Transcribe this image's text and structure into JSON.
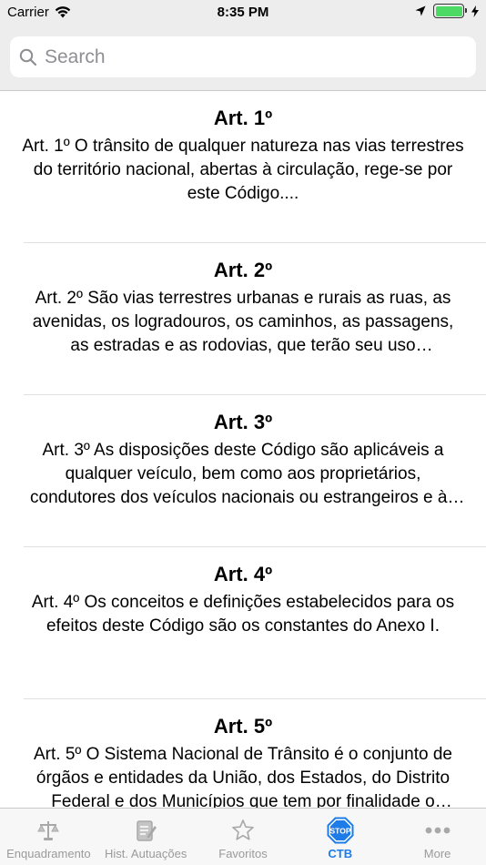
{
  "status": {
    "carrier": "Carrier",
    "time": "8:35 PM"
  },
  "search": {
    "placeholder": "Search",
    "value": ""
  },
  "articles": [
    {
      "title": "Art. 1º",
      "body": "Art. 1º O trânsito de qualquer natureza nas vias terrestres do território nacional, abertas à circulação, rege-se por este Código...."
    },
    {
      "title": "Art. 2º",
      "body": "Art. 2º São vias terrestres urbanas e rurais as ruas, as avenidas, os logradouros, os caminhos, as passagens, as estradas e as rodovias, que terão seu uso regulamentado pelo órgão ou entidade com circunscrição sobre elas, de acordo com as peculiaridades locais e as circunstâncias especiais."
    },
    {
      "title": "Art. 3º",
      "body": "Art. 3º As disposições deste Código são aplicáveis a qualquer veículo, bem como aos proprietários, condutores dos veículos nacionais ou estrangeiros e às pessoas nele expressamente mencionadas."
    },
    {
      "title": "Art. 4º",
      "body": "Art. 4º Os conceitos e definições estabelecidos para os efeitos deste Código são os constantes do Anexo I."
    },
    {
      "title": "Art. 5º",
      "body": "Art. 5º O Sistema Nacional de Trânsito é o conjunto de órgãos e entidades da União, dos Estados, do Distrito Federal e dos Municípios que tem por finalidade o exercício das atividades de planejamento."
    }
  ],
  "tabs": [
    {
      "label": "Enquadramento",
      "icon": "scales-icon"
    },
    {
      "label": "Hist. Autuações",
      "icon": "notepad-icon"
    },
    {
      "label": "Favoritos",
      "icon": "star-icon"
    },
    {
      "label": "CTB",
      "icon": "stop-sign-icon"
    },
    {
      "label": "More",
      "icon": "more-dots-icon"
    }
  ],
  "colors": {
    "accent": "#1e7ce8",
    "inactive": "#9a9a9a",
    "battery": "#4cd964"
  }
}
